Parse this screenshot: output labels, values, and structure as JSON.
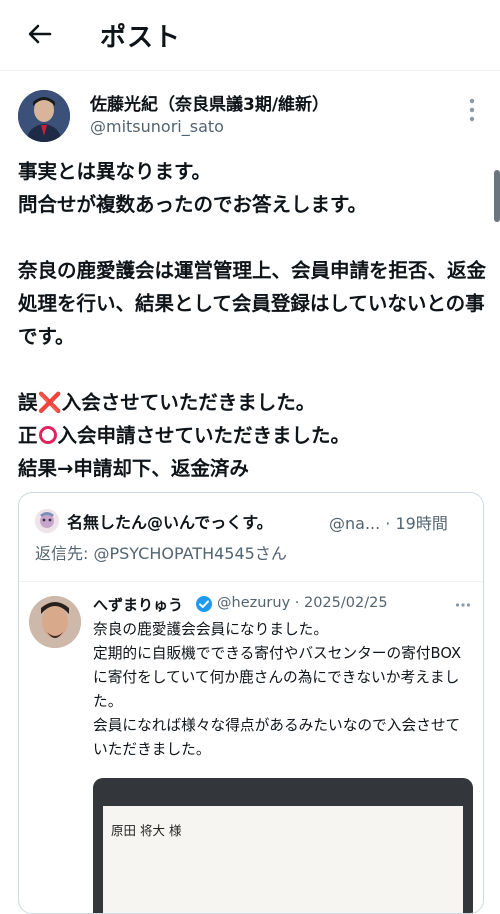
{
  "header": {
    "title": "ポスト",
    "back_icon": "back-arrow-icon"
  },
  "post": {
    "author_name": "佐藤光紀（奈良県議3期/維新）",
    "author_handle": "@mitsunori_sato",
    "text_p1": "事実とは異なります。\n問合せが複数あったのでお答えします。\n\n奈良の鹿愛護会は運営管理上、会員申請を拒否、返金処理を行い、結果として会員登録はしていないとの事です。\n\n",
    "line_wrong_prefix": "誤",
    "line_wrong_mark": "❌",
    "line_wrong_text": "入会させていただきました。",
    "line_right_prefix": "正",
    "line_right_text": "入会申請させていただきました。",
    "line_result": "結果→申請却下、返金済み"
  },
  "quote": {
    "name": "名無したん@いんでっくす。",
    "handle_time": "@na... · 19時間",
    "reply_to": "返信先: @PSYCHOPATH4545さん",
    "inner": {
      "name": "へずまりゅう",
      "meta": "@hezuruy · 2025/02/25",
      "text": "奈良の鹿愛護会会員になりました。\n定期的に自販機でできる寄付やバスセンターの寄付BOXに寄付をしていて何か鹿さんの為にできないか考えました。\n会員になれば様々な得点があるみたいなので入会させていただきました。",
      "image_text": "原田 将大 様"
    }
  },
  "colors": {
    "accent_red": "#e0245e",
    "verified_blue": "#1d9bf0",
    "muted": "#536471"
  }
}
